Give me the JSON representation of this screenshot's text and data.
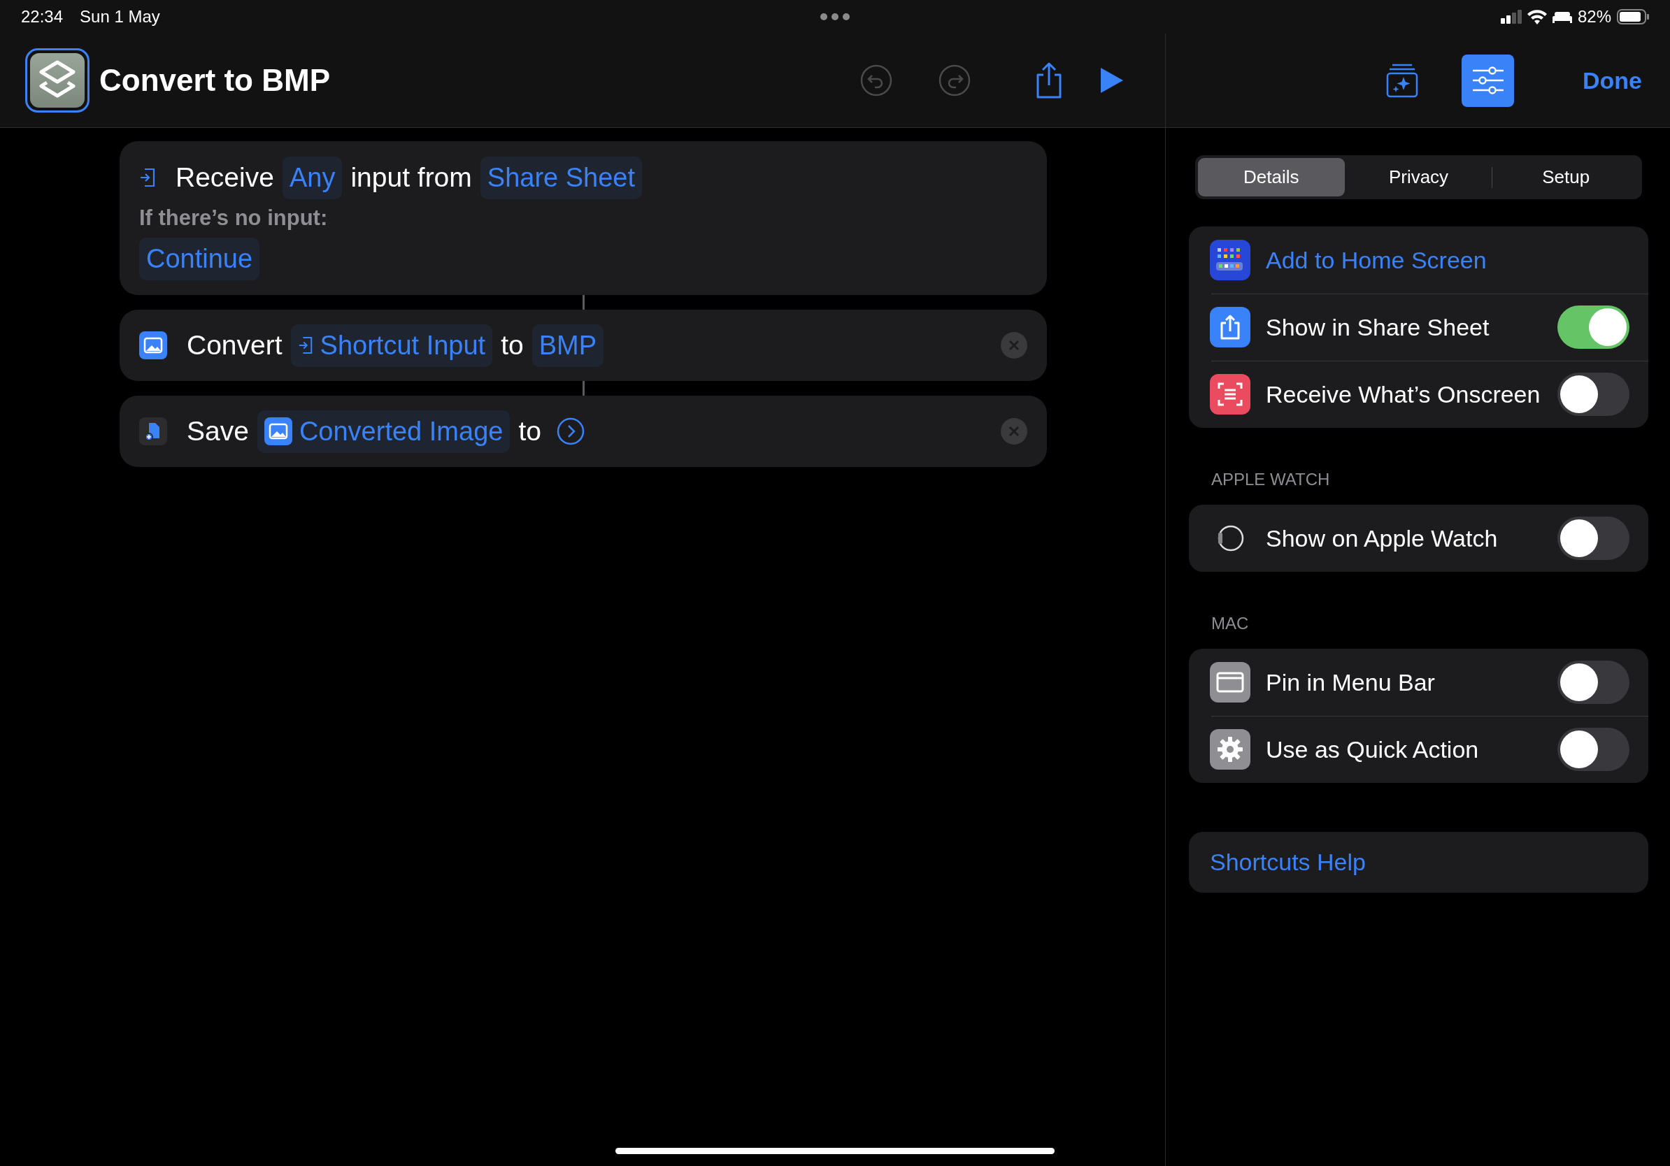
{
  "status_bar": {
    "time": "22:34",
    "date": "Sun 1 May",
    "battery": "82%"
  },
  "editor": {
    "title": "Convert to BMP",
    "toolbar": [
      {
        "kind": "undo",
        "disabled": true
      },
      {
        "kind": "redo",
        "disabled": true
      },
      {
        "kind": "share",
        "disabled": false
      },
      {
        "kind": "run",
        "disabled": false
      }
    ],
    "actions": [
      {
        "kind": "receive",
        "deletable": false,
        "lines": [
          [
            {
              "kind": "word",
              "text": "Receive"
            },
            {
              "kind": "token",
              "text": "Any"
            },
            {
              "kind": "word",
              "text": "input from"
            },
            {
              "kind": "token",
              "text": "Share Sheet"
            }
          ],
          [
            {
              "kind": "note",
              "text": "If there’s no input:"
            }
          ],
          [
            {
              "kind": "token",
              "text": "Continue"
            }
          ]
        ]
      },
      {
        "kind": "convert",
        "deletable": true,
        "lines": [
          [
            {
              "kind": "word",
              "text": "Convert"
            },
            {
              "kind": "input-token",
              "text": "Shortcut Input"
            },
            {
              "kind": "word",
              "text": "to"
            },
            {
              "kind": "token",
              "text": "BMP"
            }
          ]
        ]
      },
      {
        "kind": "save",
        "deletable": true,
        "lines": [
          [
            {
              "kind": "word",
              "text": "Save"
            },
            {
              "kind": "image-token",
              "text": "Converted Image"
            },
            {
              "kind": "word",
              "text": "to"
            },
            {
              "kind": "chevron"
            }
          ]
        ]
      }
    ]
  },
  "details": {
    "toolbar": [
      {
        "kind": "gallery",
        "selected": false
      },
      {
        "kind": "details",
        "selected": true
      }
    ],
    "done": "Done",
    "tabs": [
      {
        "label": "Details",
        "selected": true
      },
      {
        "label": "Privacy",
        "selected": false
      },
      {
        "label": "Setup",
        "selected": false
      }
    ],
    "groups": [
      {
        "items": [
          {
            "kind": "link",
            "label": "Add to Home Screen"
          },
          {
            "kind": "toggle",
            "label": "Show in Share Sheet",
            "on": true
          },
          {
            "kind": "toggle",
            "label": "Receive What’s Onscreen",
            "on": false
          }
        ]
      },
      {
        "header": "APPLE WATCH",
        "items": [
          {
            "kind": "toggle",
            "label": "Show on Apple Watch",
            "on": false
          }
        ]
      },
      {
        "header": "MAC",
        "items": [
          {
            "kind": "toggle",
            "label": "Pin in Menu Bar",
            "on": false
          },
          {
            "kind": "toggle",
            "label": "Use as Quick Action",
            "on": false
          }
        ]
      },
      {
        "items": [
          {
            "kind": "help-link",
            "label": "Shortcuts Help"
          }
        ]
      }
    ]
  }
}
